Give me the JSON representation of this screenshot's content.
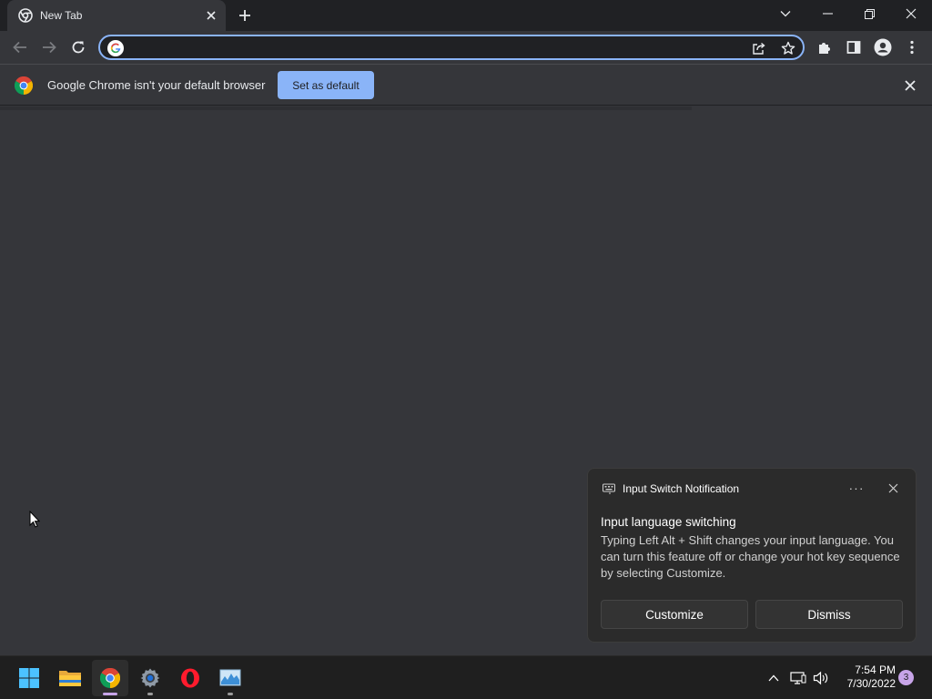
{
  "browser": {
    "tab": {
      "title": "New Tab"
    },
    "omnibox": {
      "value": "",
      "placeholder": ""
    }
  },
  "infobar": {
    "message": "Google Chrome isn't your default browser",
    "set_default_label": "Set as default"
  },
  "notification": {
    "app_name": "Input Switch Notification",
    "more_label": "···",
    "heading": "Input language switching",
    "body": "Typing Left Alt + Shift changes your input language. You can turn this feature off or change your hot key sequence by selecting Customize.",
    "customize_label": "Customize",
    "dismiss_label": "Dismiss"
  },
  "taskbar": {
    "apps": [
      "start-icon",
      "file-explorer-icon",
      "chrome-icon",
      "settings-icon",
      "opera-icon",
      "task-manager-icon"
    ],
    "time": "7:54 PM",
    "date": "7/30/2022",
    "notification_count": "3"
  },
  "colors": {
    "chrome_dark": "#202124",
    "chrome_surface": "#35363a",
    "accent": "#8ab4f8",
    "badge": "#c7a4e8"
  }
}
